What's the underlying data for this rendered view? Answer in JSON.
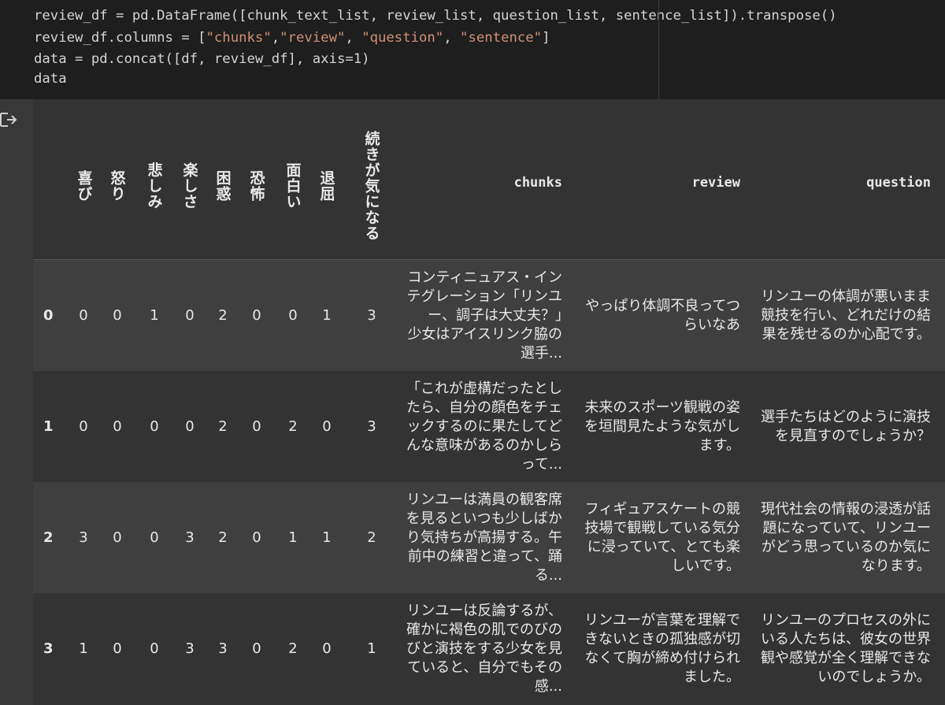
{
  "code": {
    "lines": [
      "review_df = pd.DataFrame([chunk_text_list, review_list, question_list, sentence_list]).transpose()",
      "review_df.columns = [\"chunks\",\"review\", \"question\", \"sentence\"]",
      "data = pd.concat([df, review_df], axis=1)",
      "data"
    ]
  },
  "table": {
    "emotion_headers": [
      "喜び",
      "怒り",
      "悲しみ",
      "楽しさ",
      "困惑",
      "恐怖",
      "面白い",
      "退屈",
      "続きが気になる"
    ],
    "text_headers": [
      "chunks",
      "review",
      "question"
    ],
    "rows": [
      {
        "index": "0",
        "values": [
          "0",
          "0",
          "1",
          "0",
          "2",
          "0",
          "0",
          "1",
          "3"
        ],
        "chunks": "コンティニュアス・インテグレーション「リンユー、調子は大丈夫？」　少女はアイスリンク脇の選手...",
        "review": "やっぱり体調不良ってつらいなあ",
        "question": "リンユーの体調が悪いまま競技を行い、どれだけの結果を残せるのか心配です。"
      },
      {
        "index": "1",
        "values": [
          "0",
          "0",
          "0",
          "0",
          "2",
          "0",
          "2",
          "0",
          "3"
        ],
        "chunks": "「これが虚構だったとしたら、自分の顔色をチェックするのに果たしてどんな意味があるのかしらって...",
        "review": "未来のスポーツ観戦の姿を垣間見たような気がします。",
        "question": "選手たちはどのように演技を見直すのでしょうか？"
      },
      {
        "index": "2",
        "values": [
          "3",
          "0",
          "0",
          "3",
          "2",
          "0",
          "1",
          "1",
          "2"
        ],
        "chunks": "リンユーは満員の観客席を見るといつも少しばかり気持ちが高揚する。午前中の練習と違って、踊る...",
        "review": "フィギュアスケートの競技場で観戦している気分に浸っていて、とても楽しいです。",
        "question": "現代社会の情報の浸透が話題になっていて、リンユーがどう思っているのか気になります。"
      },
      {
        "index": "3",
        "values": [
          "1",
          "0",
          "0",
          "3",
          "3",
          "0",
          "2",
          "0",
          "1"
        ],
        "chunks": "リンユーは反論するが、確かに褐色の肌でのびのびと演技をする少女を見ていると、自分でもその感...",
        "review": "リンユーが言葉を理解できないときの孤独感が切なくて胸が締め付けられました。",
        "question": "リンユーのプロセスの外にいる人たちは、彼女の世界観や感覚が全く理解できないのでしょうか。"
      }
    ]
  }
}
